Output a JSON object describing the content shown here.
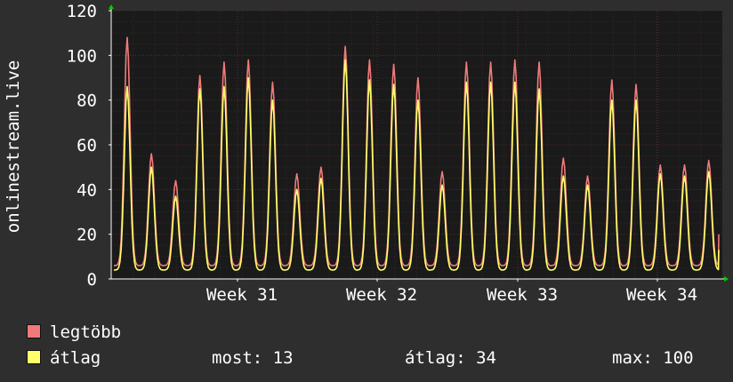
{
  "chart_data": {
    "type": "line",
    "ylabel": "onlinestream.live",
    "xlabel": "",
    "ylim": [
      0,
      120
    ],
    "y_ticks": [
      0,
      20,
      40,
      60,
      80,
      100,
      120
    ],
    "x_ticks": [
      "Week 31",
      "Week 32",
      "Week 33",
      "Week 34"
    ],
    "grid": true,
    "x": [
      1,
      2,
      3,
      4,
      5,
      6,
      7,
      8,
      9,
      10,
      11,
      12,
      13,
      14,
      15,
      16,
      17,
      18,
      19,
      20,
      21,
      22,
      23,
      24,
      25,
      26,
      27,
      28,
      29,
      30,
      31,
      32,
      33,
      34,
      35,
      36,
      37,
      38,
      39,
      40,
      41,
      42,
      43,
      44,
      45,
      46,
      47,
      48,
      49,
      50
    ],
    "series": [
      {
        "name": "legtöbb",
        "color": "#f07a7a",
        "peaks": [
          108,
          56,
          44,
          91,
          97,
          98,
          88,
          47,
          50,
          104,
          98,
          96,
          90,
          48,
          97,
          97,
          98,
          97,
          54,
          46,
          89,
          87,
          51,
          51,
          53
        ]
      },
      {
        "name": "átlag",
        "color": "#ffff6a",
        "peaks": [
          86,
          50,
          37,
          85,
          86,
          90,
          80,
          40,
          45,
          98,
          89,
          87,
          80,
          42,
          88,
          88,
          88,
          85,
          46,
          42,
          80,
          80,
          47,
          46,
          48
        ]
      }
    ]
  },
  "legend": {
    "items": [
      {
        "label": "legtöbb",
        "color": "#f07a7a"
      },
      {
        "label": "átlag",
        "color": "#ffff6a"
      }
    ]
  },
  "stats": {
    "now": "most: 13",
    "avg": "átlag: 34",
    "max": "max: 100"
  },
  "colors": {
    "background": "#2e2e2e",
    "plot_bg": "#1a1a1a",
    "grid": "#5a2a2a",
    "axis": "#ffffff",
    "arrow": "#00cc00"
  }
}
